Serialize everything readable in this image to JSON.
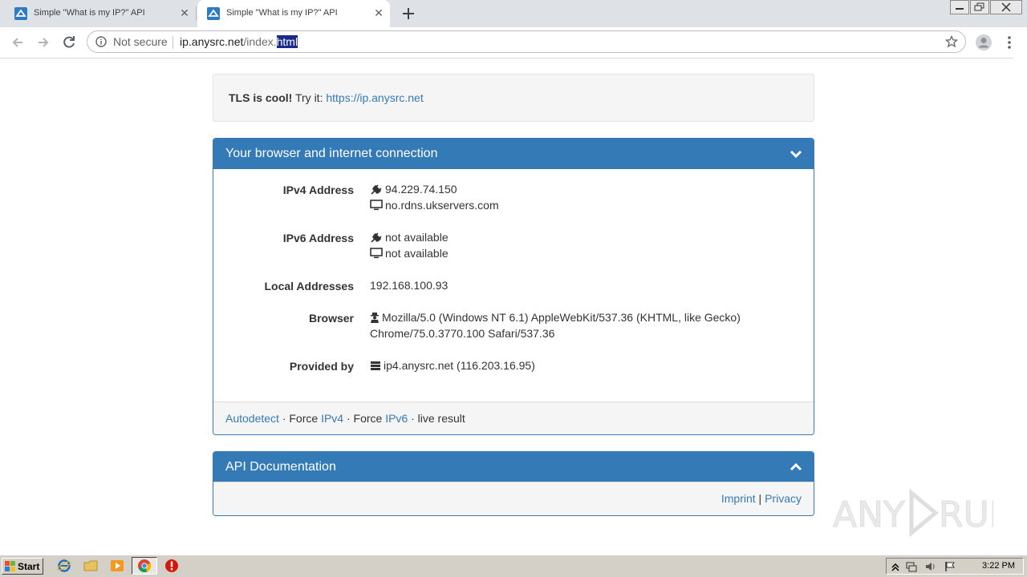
{
  "browser": {
    "tabs": [
      {
        "title": "Simple \"What is my IP?\" API",
        "active": false
      },
      {
        "title": "Simple \"What is my IP?\" API",
        "active": true
      }
    ],
    "omnibox": {
      "security_label": "Not secure",
      "url_host": "ip.anysrc.net",
      "url_path": "/index.",
      "url_selected": "html"
    }
  },
  "page": {
    "alert": {
      "bold": "TLS is cool!",
      "text": " Try it: ",
      "link": "https://ip.anysrc.net"
    },
    "connection_panel": {
      "title": "Your browser and internet connection",
      "rows": [
        {
          "label": "IPv4 Address",
          "lines": [
            {
              "icon": "plug-icon",
              "text": "94.229.74.150"
            },
            {
              "icon": "monitor-icon",
              "text": "no.rdns.ukservers.com"
            }
          ]
        },
        {
          "label": "IPv6 Address",
          "lines": [
            {
              "icon": "plug-icon",
              "text": "not available"
            },
            {
              "icon": "monitor-icon",
              "text": "not available"
            }
          ]
        },
        {
          "label": "Local Addresses",
          "lines": [
            {
              "icon": "",
              "text": "192.168.100.93"
            }
          ]
        },
        {
          "label": "Browser",
          "lines": [
            {
              "icon": "user-secret-icon",
              "text": "Mozilla/5.0 (Windows NT 6.1) AppleWebKit/537.36 (KHTML, like Gecko)"
            },
            {
              "icon": "",
              "text": "Chrome/75.0.3770.100 Safari/537.36"
            }
          ]
        },
        {
          "label": "Provided by",
          "lines": [
            {
              "icon": "server-icon",
              "text": "ip4.anysrc.net (116.203.16.95)"
            }
          ]
        }
      ],
      "footer": {
        "autodetect": "Autodetect",
        "sep1": " · Force ",
        "ipv4": "IPv4",
        "sep2": " · Force ",
        "ipv6": "IPv6",
        "sep3": " · live result"
      }
    },
    "api_panel": {
      "title": "API Documentation",
      "imprint": "Imprint",
      "sep": " | ",
      "privacy": "Privacy"
    },
    "watermark": "ANY RUN"
  },
  "taskbar": {
    "start_label": "Start",
    "clock": "3:22 PM"
  },
  "colors": {
    "primary": "#337ab7",
    "panel_footer": "#f5f5f5",
    "tabstrip": "#dee1e6"
  }
}
